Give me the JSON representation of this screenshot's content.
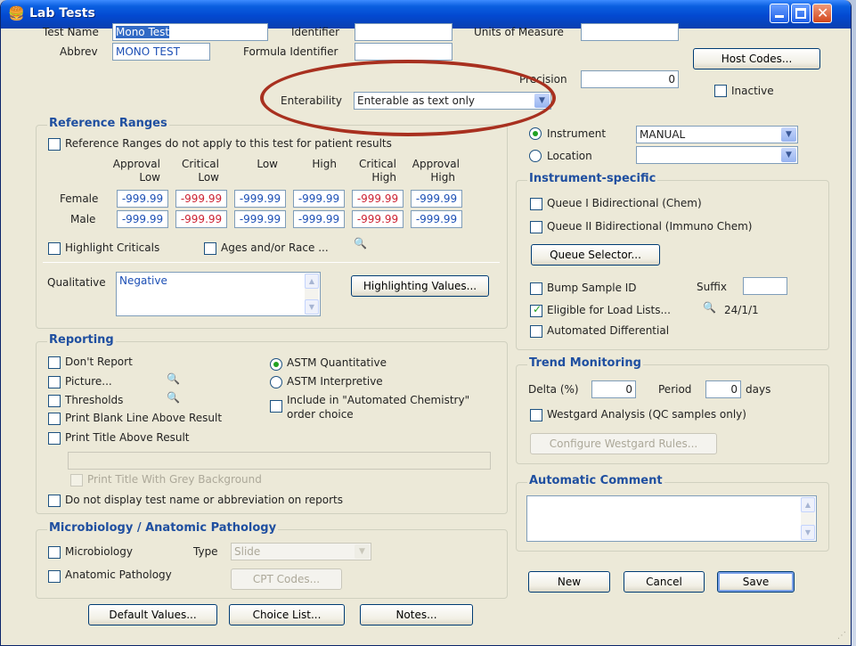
{
  "window": {
    "title": "Lab Tests"
  },
  "top": {
    "test_name_label": "Test Name",
    "test_name_value": "Mono Test",
    "abbrev_label": "Abbrev",
    "abbrev_value": "MONO TEST",
    "identifier_label": "Identifier",
    "identifier_value": "",
    "formula_label": "Formula Identifier",
    "formula_value": "",
    "enterability_label": "Enterability",
    "enterability_value": "Enterable as text only",
    "units_label": "Units of Measure",
    "units_value": "",
    "precision_label": "Precision",
    "precision_value": "0",
    "host_codes": "Host Codes...",
    "inactive_label": "Inactive"
  },
  "ref": {
    "title": "Reference Ranges",
    "not_apply": "Reference Ranges do not apply to this test for patient results",
    "headers": [
      [
        "Approval",
        "Low"
      ],
      [
        "Critical",
        "Low"
      ],
      [
        "",
        "Low"
      ],
      [
        "",
        "High"
      ],
      [
        "Critical",
        "High"
      ],
      [
        "Approval",
        "High"
      ]
    ],
    "female_label": "Female",
    "male_label": "Male",
    "female": [
      "-999.99",
      "-999.99",
      "-999.99",
      "-999.99",
      "-999.99",
      "-999.99"
    ],
    "male": [
      "-999.99",
      "-999.99",
      "-999.99",
      "-999.99",
      "-999.99",
      "-999.99"
    ],
    "highlight_criticals": "Highlight Criticals",
    "ages_race": "Ages and/or Race ...",
    "qualitative_label": "Qualitative",
    "qualitative_value": "Negative",
    "highlighting_values": "Highlighting Values..."
  },
  "reporting": {
    "title": "Reporting",
    "dont_report": "Don't Report",
    "picture": "Picture...",
    "thresholds": "Thresholds",
    "blank_line": "Print Blank Line Above Result",
    "title_above": "Print Title Above Result",
    "title_grey": "Print Title With Grey Background",
    "no_display": "Do not display test name or abbreviation on reports",
    "astm_quant": "ASTM Quantitative",
    "astm_interp": "ASTM Interpretive",
    "include_auto_1": "Include in \"Automated Chemistry\"",
    "include_auto_2": "order choice"
  },
  "micro": {
    "title": "Microbiology / Anatomic Pathology",
    "microbiology": "Microbiology",
    "type_label": "Type",
    "type_value": "Slide",
    "anatomic": "Anatomic Pathology",
    "cpt_codes": "CPT Codes..."
  },
  "bottom": {
    "default_values": "Default Values...",
    "choice_list": "Choice List...",
    "notes": "Notes...",
    "new": "New",
    "cancel": "Cancel",
    "save": "Save"
  },
  "instrument": {
    "instrument_label": "Instrument",
    "instrument_value": "MANUAL",
    "location_label": "Location",
    "location_value": ""
  },
  "specific": {
    "title": "Instrument-specific",
    "queue1": "Queue I Bidirectional (Chem)",
    "queue2": "Queue II Bidirectional (Immuno Chem)",
    "queue_selector": "Queue Selector...",
    "bump": "Bump Sample ID",
    "suffix_label": "Suffix",
    "suffix_value": "",
    "eligible": "Eligible for Load Lists...",
    "eligible_code": "24/1/1",
    "auto_diff": "Automated Differential"
  },
  "trend": {
    "title": "Trend Monitoring",
    "delta_label": "Delta (%)",
    "delta_value": "0",
    "period_label": "Period",
    "period_value": "0",
    "days_label": "days",
    "westgard": "Westgard Analysis (QC samples only)",
    "configure": "Configure Westgard Rules..."
  },
  "auto_comment": {
    "title": "Automatic Comment",
    "value": ""
  },
  "colors": {
    "titlebar": "#0a5fe0",
    "group_title": "#1f4fa0",
    "annotation": "#a8301f",
    "critical": "#cc2233",
    "approval": "#1c4fb5"
  }
}
